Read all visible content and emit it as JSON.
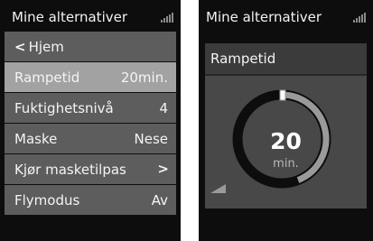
{
  "left_screen": {
    "title": "Mine alternativer",
    "back_label": "Hjem",
    "items": [
      {
        "label": "Rampetid",
        "value": "20min."
      },
      {
        "label": "Fuktighetsnivå",
        "value": "4"
      },
      {
        "label": "Maske",
        "value": "Nese"
      },
      {
        "label": "Kjør masketilpas",
        "value": ""
      },
      {
        "label": "Flymodus",
        "value": "Av"
      }
    ]
  },
  "right_screen": {
    "title": "Mine alternativer",
    "panel_title": "Rampetid",
    "gauge_value": "20",
    "gauge_unit": "min.",
    "gauge_fraction": 0.44
  },
  "icons": {
    "signal": "signal-strength-icon",
    "back": "chevron-left-icon",
    "forward": "chevron-right-icon",
    "ramp": "ramp-triangle-icon"
  },
  "colors": {
    "background": "#0d0d0d",
    "item": "#5d5d5d",
    "item_selected": "#a2a2a2",
    "gauge_track": "#0d0d0d",
    "gauge_fill": "#9a9a9a"
  }
}
